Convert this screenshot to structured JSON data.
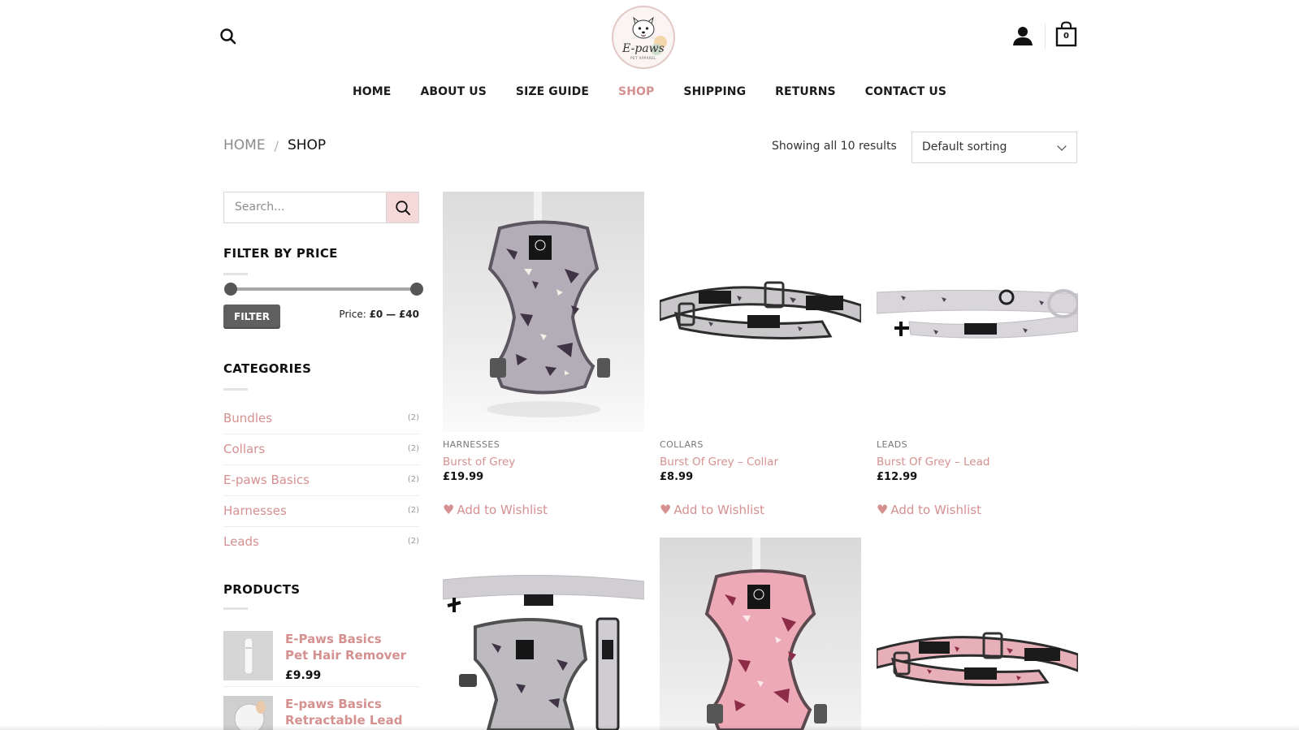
{
  "header": {
    "logo_text": "E-paws",
    "logo_tagline": "PET APPAREL",
    "cart_count": "0",
    "nav": [
      {
        "label": "HOME"
      },
      {
        "label": "ABOUT US"
      },
      {
        "label": "SIZE GUIDE"
      },
      {
        "label": "SHOP"
      },
      {
        "label": "SHIPPING"
      },
      {
        "label": "RETURNS"
      },
      {
        "label": "CONTACT US"
      }
    ],
    "active_nav": "SHOP"
  },
  "breadcrumb": {
    "home": "HOME",
    "separator": "/",
    "current": "SHOP"
  },
  "toolbar": {
    "result_count": "Showing all 10 results",
    "sort_selected": "Default sorting"
  },
  "sidebar": {
    "search_placeholder": "Search...",
    "filter_title": "FILTER BY PRICE",
    "filter_button": "FILTER",
    "price_prefix": "Price:",
    "price_min": "£0",
    "price_dash": "—",
    "price_max": "£40",
    "categories_title": "CATEGORIES",
    "categories": [
      {
        "name": "Bundles",
        "count": "(2)"
      },
      {
        "name": "Collars",
        "count": "(2)"
      },
      {
        "name": "E-paws Basics",
        "count": "(2)"
      },
      {
        "name": "Harnesses",
        "count": "(2)"
      },
      {
        "name": "Leads",
        "count": "(2)"
      }
    ],
    "products_title": "PRODUCTS",
    "products": [
      {
        "name": "E-Paws Basics Pet Hair Remover",
        "price": "£9.99"
      },
      {
        "name": "E-paws Basics Retractable Lead",
        "price": ""
      }
    ]
  },
  "products": [
    {
      "category": "HARNESSES",
      "name": "Burst of Grey",
      "price": "£19.99",
      "wishlist": "Add to Wishlist"
    },
    {
      "category": "COLLARS",
      "name": "Burst Of Grey – Collar",
      "price": "£8.99",
      "wishlist": "Add to Wishlist"
    },
    {
      "category": "LEADS",
      "name": "Burst Of Grey – Lead",
      "price": "£12.99",
      "wishlist": "Add to Wishlist"
    }
  ],
  "colors": {
    "accent": "#d59090",
    "filter_button": "#5f5f5f",
    "search_button": "#f4d9d8"
  }
}
